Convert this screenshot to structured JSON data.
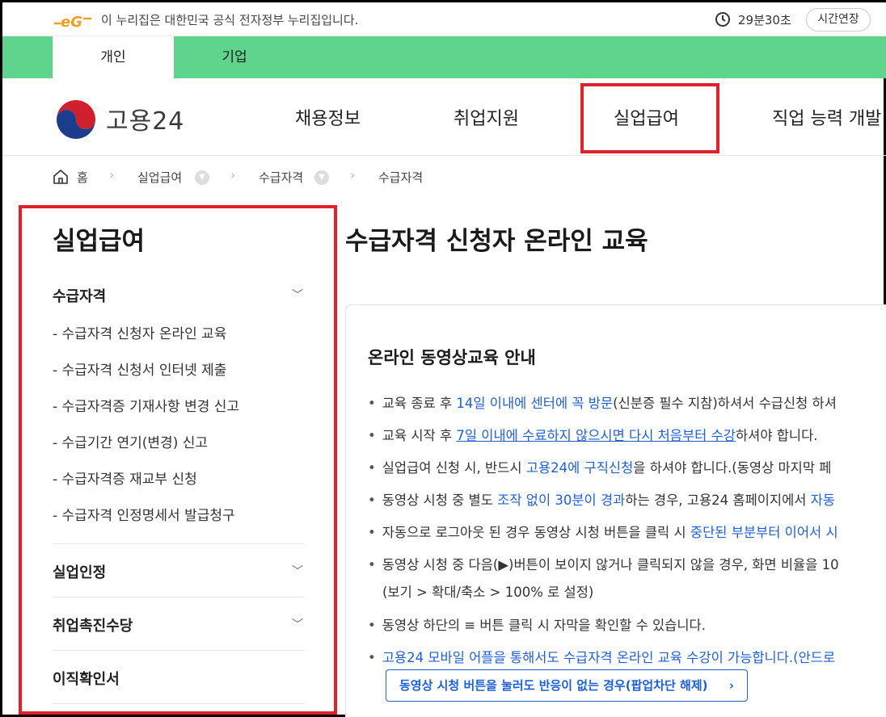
{
  "gov_bar": {
    "notice": "이 누리집은 대한민국 공식 전자정부 누리집입니다.",
    "timer": "29분30초",
    "extend_label": "시간연장"
  },
  "tabs": [
    {
      "label": "개인",
      "active": true
    },
    {
      "label": "기업",
      "active": false
    }
  ],
  "header": {
    "logo_text": "고용24",
    "nav": [
      "채용정보",
      "취업지원",
      "실업급여",
      "직업 능력 개발"
    ],
    "highlighted_nav": "실업급여"
  },
  "breadcrumb": [
    "홈",
    "실업급여",
    "수급자격",
    "수급자격"
  ],
  "sidebar": {
    "title": "실업급여",
    "sections": [
      {
        "label": "수급자격",
        "expanded": true,
        "items": [
          "- 수급자격 신청자 온라인 교육",
          "- 수급자격 신청서 인터넷 제출",
          "- 수급자격증 기재사항 변경 신고",
          "- 수급기간 연기(변경) 신고",
          "- 수급자격증 재교부 신청",
          "- 수급자격 인정명세서 발급청구"
        ]
      },
      {
        "label": "실업인정",
        "expanded": false
      },
      {
        "label": "취업촉진수당",
        "expanded": false
      },
      {
        "label": "이직확인서",
        "expanded": false
      }
    ]
  },
  "main": {
    "title": "수급자격 신청자 온라인 교육",
    "card_title": "온라인 동영상교육 안내",
    "bullets": {
      "b1": {
        "a": "교육 종료 후 ",
        "b": "14일 이내에 센터에 꼭 방문",
        "c": "(신분증 필수 지참)하셔서 수급신청 하셔"
      },
      "b2": {
        "a": "교육 시작 후 ",
        "b": "7일 이내에 수료하지 않으시면 다시 처음부터 수강",
        "c": "하셔야 합니다."
      },
      "b3": {
        "a": "실업급여 신청 시, 반드시 ",
        "b": "고용24에 구직신청",
        "c": "을 하셔야 합니다.(동영상 마지막 페"
      },
      "b4": {
        "a": "동영상 시청 중 별도 ",
        "b": "조작 없이 30분이 경과",
        "c": "하는 경우, 고용24 홈페이지에서 ",
        "d": "자동"
      },
      "b5": {
        "a": "자동으로 로그아웃 된 경우 동영상 시청 버튼을 클릭 시 ",
        "b": "중단된 부분부터 이어서 시"
      },
      "b6": {
        "a": "동영상 시청 중 다음(▶)버튼이 보이지 않거나 클릭되지 않을 경우, 화면 비율을 10",
        "cont": "(보기 > 확대/축소 > 100% 로 설정)"
      },
      "b7": {
        "a": "동영상 하단의 ≡ 버튼 클릭 시 자막을 확인할 수 있습니다."
      },
      "b8": {
        "a": "고용24 모바일 어플을 통해서도 수급자격 온라인 교육 수강이 가능합니다.(안드로"
      }
    },
    "popup_button": "동영상 시청 버튼을 눌러도 반응이 없는 경우(팝업차단 해제)",
    "popup_arrow": "›"
  },
  "colors": {
    "tab_green": "#5fd48d",
    "highlight_red": "#e0202a",
    "link_blue": "#1f5fd6"
  }
}
